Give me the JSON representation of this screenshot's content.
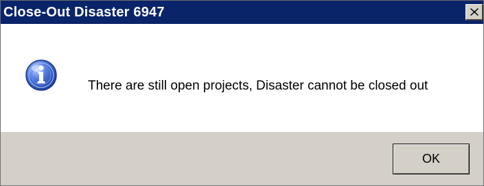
{
  "window": {
    "title": "Close-Out Disaster 6947",
    "close_icon": "close-icon"
  },
  "message": {
    "icon": "info-icon",
    "text": "There are still open projects, Disaster cannot be closed out"
  },
  "buttons": {
    "ok_label": "OK"
  },
  "colors": {
    "titlebar": "#0a246a",
    "title_text": "#ffffff",
    "content_background": "#ffffff",
    "footer_background": "#d4d0c8",
    "icon_blue": "#2a56c6"
  }
}
